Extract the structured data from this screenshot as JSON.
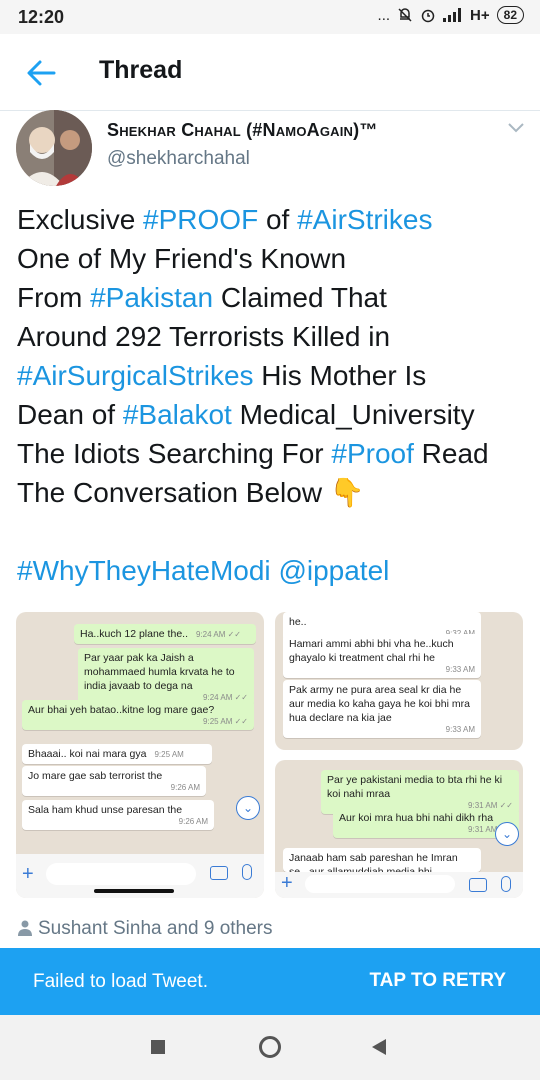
{
  "status": {
    "time": "12:20",
    "icons_text": "... ",
    "signal": "H+",
    "battery": "82"
  },
  "header": {
    "title": "Thread",
    "back_icon": "back-arrow-icon"
  },
  "author": {
    "name": "Shekhar Chahal (#NamoAgain)™",
    "handle": "@shekharchahal"
  },
  "tweet": {
    "line1": {
      "t1": "Exclusive ",
      "h1": "#PROOF",
      "t2": " of ",
      "h2": "#AirStrikes"
    },
    "line2": {
      "t1": "One of My Friend's Known"
    },
    "line3": {
      "t1": "From ",
      "h1": "#Pakistan",
      "t2": " Claimed That"
    },
    "line4": {
      "t1": "Around 292 Terrorists Killed in"
    },
    "line5": {
      "h1": "#AirSurgicalStrikes",
      "t1": " His Mother Is"
    },
    "line6": {
      "t1": "Dean of ",
      "h1": "#Balakot",
      "t2": " Medical_University"
    },
    "line7": {
      "t1": "The Idiots Searching For ",
      "h1": "#Proof",
      "t2": " Read"
    },
    "line8": {
      "t1": "The Conversation Below ",
      "emoji": "👇"
    },
    "line9": {
      "h1": "#WhyTheyHateModi",
      "t1": " ",
      "h2": "@ippatel"
    }
  },
  "images": {
    "img1": {
      "m1": "Ha..kuch 12 plane the..",
      "m1t": "9:24 AM ✓✓",
      "m2": "Par yaar pak ka Jaish a mohammaed humla krvata he to india javaab to dega na",
      "m2t": "9:24 AM ✓✓",
      "m3": "Aur bhai yeh batao..kitne log mare gae?",
      "m3t": "9:25 AM ✓✓",
      "m4": "Bhaaai.. koi nai mara gya",
      "m4t": "9:25 AM",
      "m5": "Jo mare gae sab terrorist the",
      "m5t": "9:26 AM",
      "m6": "Sala ham khud unse paresan the",
      "m6t": "9:26 AM"
    },
    "img2": {
      "m1": "he..",
      "m1t": "9:32 AM",
      "m2": "Hamari ammi abhi bhi vha he..kuch ghayalo ki treatment chal rhi he",
      "m2t": "9:33 AM",
      "m3": "Pak army ne pura area seal kr dia he aur media ko kaha gaya he koi bhi mra hua declare na kia jae",
      "m3t": "9:33 AM"
    },
    "img3": {
      "m1": "Par ye pakistani media to bta rhi he ki koi nahi mraa",
      "m1t": "9:31 AM ✓✓",
      "m2": "Aur koi mra hua bhi nahi dikh rha",
      "m2t": "9:31 AM ✓✓",
      "m3": "Janaab ham sab pareshan he Imran se...aur allamuddiah media bhi"
    }
  },
  "likes": {
    "text": "Sushant Sinha and 9 others"
  },
  "banner": {
    "message": "Failed to load Tweet.",
    "retry": "TAP TO RETRY"
  },
  "colors": {
    "accent": "#1da1f2",
    "hashtag": "#1b95e0",
    "secondary_text": "#657786"
  }
}
